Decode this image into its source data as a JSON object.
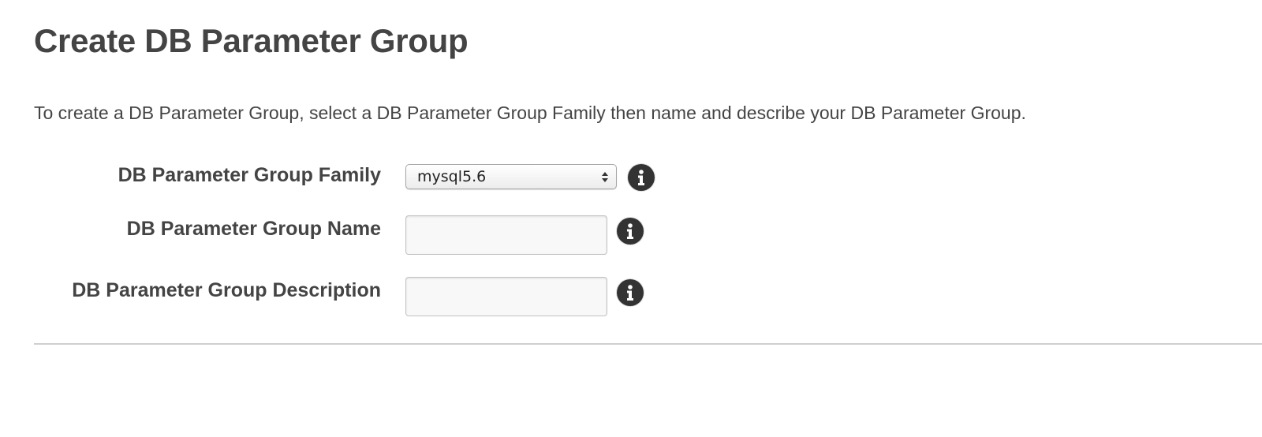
{
  "page": {
    "title": "Create DB Parameter Group",
    "intro": "To create a DB Parameter Group, select a DB Parameter Group Family then name and describe your DB Parameter Group."
  },
  "form": {
    "family": {
      "label": "DB Parameter Group Family",
      "selected_value": "mysql5.6",
      "info_icon": "info-icon"
    },
    "name": {
      "label": "DB Parameter Group Name",
      "value": "",
      "info_icon": "info-icon"
    },
    "description": {
      "label": "DB Parameter Group Description",
      "value": "",
      "info_icon": "info-icon"
    }
  },
  "colors": {
    "text": "#444444",
    "info_icon": "#333333",
    "divider": "#cfcfcf",
    "input_background": "#f8f8f8"
  }
}
